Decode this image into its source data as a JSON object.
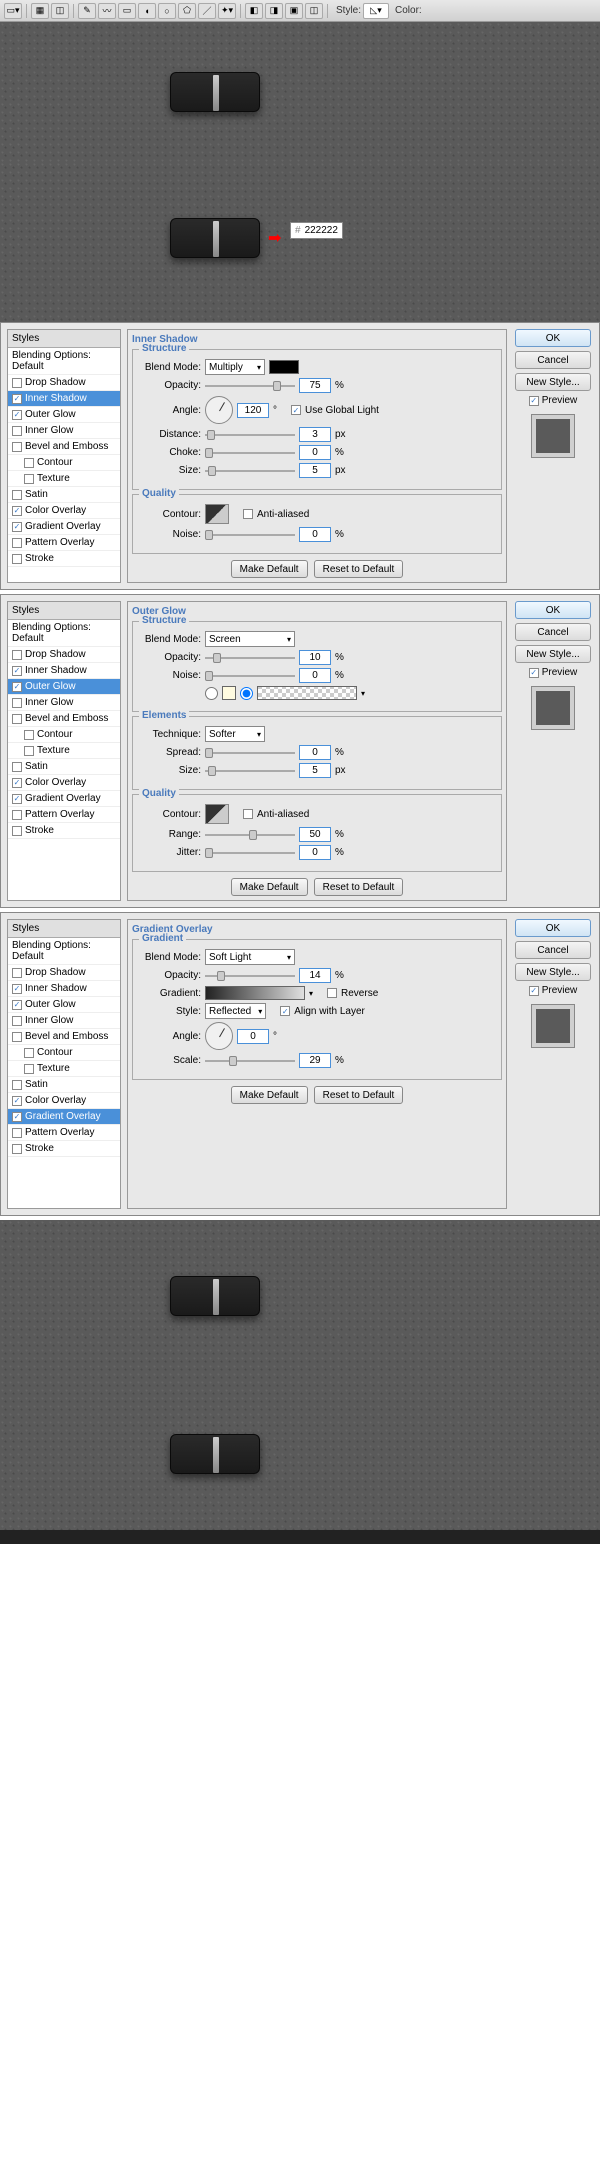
{
  "toolbar": {
    "style_label": "Style:",
    "color_label": "Color:"
  },
  "colorhint": {
    "hash": "#",
    "value": "222222"
  },
  "styles_panel": {
    "header": "Styles",
    "blending": "Blending Options: Default",
    "items": [
      "Drop Shadow",
      "Inner Shadow",
      "Outer Glow",
      "Inner Glow",
      "Bevel and Emboss",
      "Contour",
      "Texture",
      "Satin",
      "Color Overlay",
      "Gradient Overlay",
      "Pattern Overlay",
      "Stroke"
    ]
  },
  "panel1": {
    "title": "Inner Shadow",
    "structure": "Structure",
    "blend_mode_l": "Blend Mode:",
    "blend_mode": "Multiply",
    "opacity_l": "Opacity:",
    "opacity": "75",
    "pct": "%",
    "angle_l": "Angle:",
    "angle": "120",
    "deg": "°",
    "uga": "Use Global Light",
    "distance_l": "Distance:",
    "distance": "3",
    "px": "px",
    "choke_l": "Choke:",
    "choke": "0",
    "size_l": "Size:",
    "size": "5",
    "quality": "Quality",
    "contour_l": "Contour:",
    "aa": "Anti-aliased",
    "noise_l": "Noise:",
    "noise": "0",
    "make_def": "Make Default",
    "reset_def": "Reset to Default"
  },
  "panel2": {
    "title": "Outer Glow",
    "structure": "Structure",
    "blend_mode_l": "Blend Mode:",
    "blend_mode": "Screen",
    "opacity_l": "Opacity:",
    "opacity": "10",
    "pct": "%",
    "noise_l": "Noise:",
    "noise": "0",
    "elements": "Elements",
    "technique_l": "Technique:",
    "technique": "Softer",
    "spread_l": "Spread:",
    "spread": "0",
    "size_l": "Size:",
    "size": "5",
    "px": "px",
    "quality": "Quality",
    "contour_l": "Contour:",
    "aa": "Anti-aliased",
    "range_l": "Range:",
    "range": "50",
    "jitter_l": "Jitter:",
    "jitter": "0",
    "make_def": "Make Default",
    "reset_def": "Reset to Default"
  },
  "panel3": {
    "title": "Gradient Overlay",
    "gradient_h": "Gradient",
    "blend_mode_l": "Blend Mode:",
    "blend_mode": "Soft Light",
    "opacity_l": "Opacity:",
    "opacity": "14",
    "pct": "%",
    "gradient_l": "Gradient:",
    "reverse": "Reverse",
    "style_l": "Style:",
    "style": "Reflected",
    "align": "Align with Layer",
    "angle_l": "Angle:",
    "angle": "0",
    "deg": "°",
    "scale_l": "Scale:",
    "scale": "29",
    "make_def": "Make Default",
    "reset_def": "Reset to Default"
  },
  "buttons": {
    "ok": "OK",
    "cancel": "Cancel",
    "new_style": "New Style...",
    "preview": "Preview"
  },
  "checked": {
    "p1": [
      "Inner Shadow",
      "Outer Glow",
      "Color Overlay",
      "Gradient Overlay"
    ],
    "p2": [
      "Inner Shadow",
      "Outer Glow",
      "Color Overlay",
      "Gradient Overlay"
    ],
    "p3": [
      "Inner Shadow",
      "Outer Glow",
      "Color Overlay",
      "Gradient Overlay"
    ]
  },
  "active": {
    "p1": "Inner Shadow",
    "p2": "Outer Glow",
    "p3": "Gradient Overlay"
  }
}
